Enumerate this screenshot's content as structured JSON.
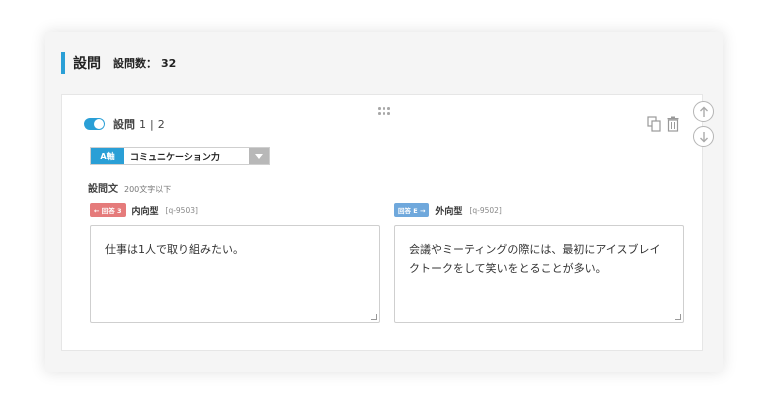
{
  "section": {
    "title": "設問",
    "count_label": "設問数：",
    "count_value": "32"
  },
  "question": {
    "label": "設問",
    "number": "1",
    "separator": "|",
    "total": "2",
    "icons": {
      "copy": "copy-icon",
      "delete": "trash-icon",
      "move_up": "arrow-up-circle-icon",
      "move_down": "arrow-down-circle-icon",
      "drag": "drag-handle-icon"
    }
  },
  "category": {
    "badge": "A軸",
    "value": "コミュニケーション力"
  },
  "question_text": {
    "label": "設問文",
    "limit": "200文字以下"
  },
  "options": [
    {
      "badge": "← 回答 3",
      "type": "内向型",
      "code": "[q-9503]",
      "text": "仕事は1人で取り組みたい。"
    },
    {
      "badge": "回答 E →",
      "type": "外向型",
      "code": "[q-9502]",
      "text": "会議やミーティングの際には、最初にアイスブレイクトークをして笑いをとることが多い。"
    }
  ],
  "colors": {
    "accent": "#2a9fd6",
    "left_badge": "#e57b7b",
    "right_badge": "#6fa8dc"
  }
}
